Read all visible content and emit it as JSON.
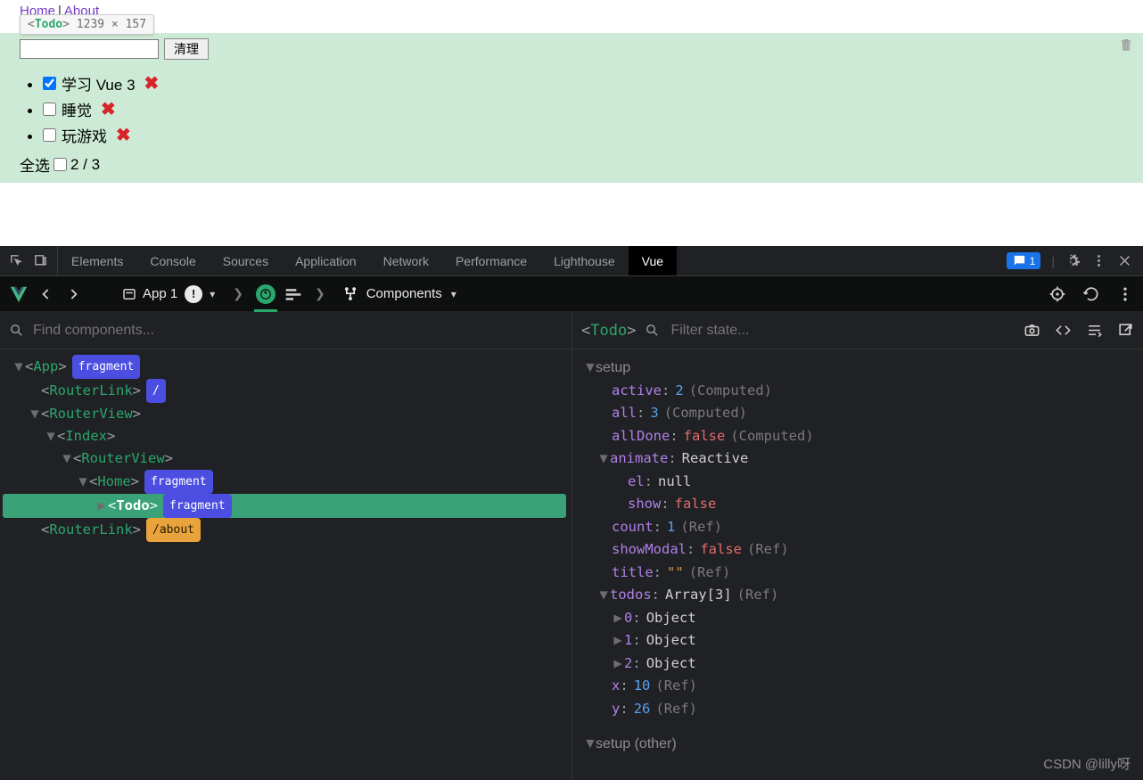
{
  "page": {
    "nav": {
      "home": "Home",
      "about": "About"
    },
    "tooltip": {
      "tag": "Todo",
      "dims": "1239 × 157"
    },
    "input_value": "",
    "clean_btn": "清理",
    "todos": [
      {
        "label": "学习 Vue 3",
        "checked": true
      },
      {
        "label": "睡觉",
        "checked": false
      },
      {
        "label": "玩游戏",
        "checked": false
      }
    ],
    "select_all_label": "全选",
    "counter": "2 / 3"
  },
  "devtools": {
    "tabs": [
      "Elements",
      "Console",
      "Sources",
      "Application",
      "Network",
      "Performance",
      "Lighthouse",
      "Vue"
    ],
    "active_tab": "Vue",
    "issue_count": "1"
  },
  "vue_toolbar": {
    "app_label": "App 1",
    "components_label": "Components"
  },
  "tree": {
    "search_placeholder": "Find components...",
    "nodes": [
      {
        "indent": 0,
        "tw": "▼",
        "name": "App",
        "badge_blue": "fragment"
      },
      {
        "indent": 1,
        "tw": "",
        "name": "RouterLink",
        "badge_blue": "/"
      },
      {
        "indent": 1,
        "tw": "▼",
        "name": "RouterView"
      },
      {
        "indent": 2,
        "tw": "▼",
        "name": "Index"
      },
      {
        "indent": 3,
        "tw": "▼",
        "name": "RouterView"
      },
      {
        "indent": 4,
        "tw": "▼",
        "name": "Home",
        "badge_blue": "fragment"
      },
      {
        "indent": 5,
        "tw": "▶",
        "name": "Todo",
        "badge_blue": "fragment",
        "selected": true
      },
      {
        "indent": 1,
        "tw": "",
        "name": "RouterLink",
        "badge_orange": "/about"
      }
    ]
  },
  "right": {
    "comp_name": "Todo",
    "filter_placeholder": "Filter state...",
    "section1": "setup",
    "section2": "setup (other)",
    "state": {
      "active": {
        "v": "2",
        "note": "(Computed)"
      },
      "all": {
        "v": "3",
        "note": "(Computed)"
      },
      "allDone": {
        "v": "false",
        "note": "(Computed)",
        "is_red": true
      },
      "animate": {
        "v": "Reactive"
      },
      "el": {
        "v": "null"
      },
      "show": {
        "v": "false",
        "is_red": true
      },
      "count": {
        "v": "1",
        "note": "(Ref)"
      },
      "showModal": {
        "v": "false",
        "note": "(Ref)",
        "is_red": true
      },
      "title": {
        "v": "\"\"",
        "note": "(Ref)",
        "is_orange": true
      },
      "todos": {
        "v": "Array[3]",
        "note": "(Ref)"
      },
      "t0": {
        "k": "0",
        "v": "Object"
      },
      "t1": {
        "k": "1",
        "v": "Object"
      },
      "t2": {
        "k": "2",
        "v": "Object"
      },
      "x": {
        "v": "10",
        "note": "(Ref)"
      },
      "y": {
        "v": "26",
        "note": "(Ref)"
      }
    }
  },
  "watermark": "CSDN @lilly呀"
}
